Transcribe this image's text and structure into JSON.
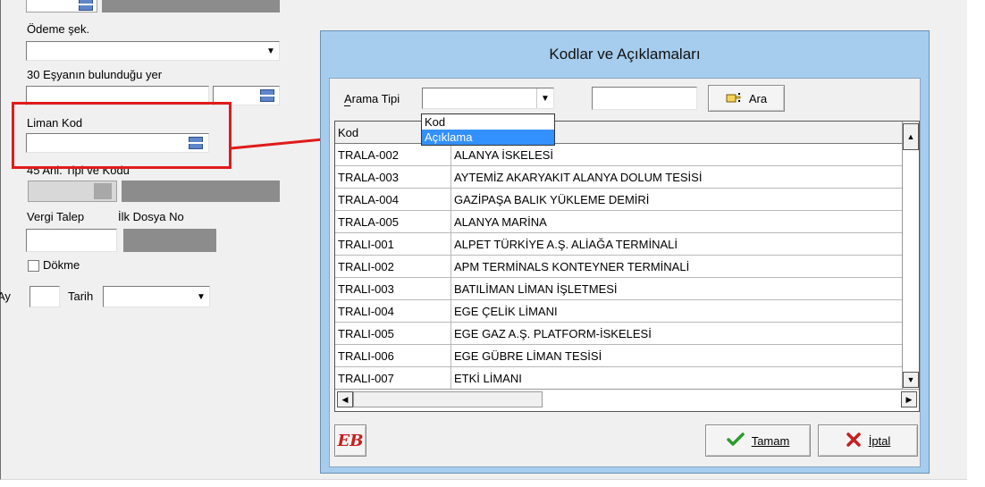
{
  "form": {
    "odeme_label": "Ödeme şek.",
    "esya_label": "30 Eşyanın bulunduğu yer",
    "liman_label": "Liman Kod",
    "anl_label": "45 Anl. Tipi ve Kodu",
    "vergi_label": "Vergi Talep",
    "ilk_dosya_label": "İlk Dosya No",
    "dokme_label": "Dökme",
    "ay_label": "Ay",
    "tarih_label": "Tarih"
  },
  "dialog": {
    "title": "Kodlar ve Açıklamaları",
    "arama_tipi_label": "Arama Tipi",
    "arama_tipi_value": "",
    "search_value": "",
    "ara_label": "Ara",
    "dropdown_options": [
      "Kod",
      "Açıklama"
    ],
    "dropdown_selected": "Açıklama",
    "grid": {
      "header_kod": "Kod",
      "header_aciklama": "",
      "rows": [
        {
          "kod": "TRALA-002",
          "aciklama": "ALANYA İSKELESİ"
        },
        {
          "kod": "TRALA-003",
          "aciklama": "AYTEMİZ AKARYAKIT ALANYA DOLUM TESİSİ"
        },
        {
          "kod": "TRALA-004",
          "aciklama": "GAZİPAŞA BALIK YÜKLEME DEMİRİ"
        },
        {
          "kod": "TRALA-005",
          "aciklama": "ALANYA MARİNA"
        },
        {
          "kod": "TRALI-001",
          "aciklama": "ALPET TÜRKİYE A.Ş. ALİAĞA TERMİNALİ"
        },
        {
          "kod": "TRALI-002",
          "aciklama": "APM TERMİNALS KONTEYNER TERMİNALİ"
        },
        {
          "kod": "TRALI-003",
          "aciklama": "BATILİMAN LİMAN İŞLETMESİ"
        },
        {
          "kod": "TRALI-004",
          "aciklama": "EGE ÇELİK LİMANI"
        },
        {
          "kod": "TRALI-005",
          "aciklama": "EGE GAZ A.Ş. PLATFORM-İSKELESİ"
        },
        {
          "kod": "TRALI-006",
          "aciklama": "EGE GÜBRE LİMAN TESİSİ"
        },
        {
          "kod": "TRALI-007",
          "aciklama": "ETKİ LİMANI"
        }
      ]
    },
    "logo_text": "EB",
    "tamam_label": "Tamam",
    "iptal_label": "İptal"
  },
  "colors": {
    "annotation": "#e01b1b",
    "dialog_frame": "#a6cdee",
    "selection": "#3390ff",
    "ok_check": "#2e9a2e",
    "cancel_x": "#c81e1e"
  }
}
